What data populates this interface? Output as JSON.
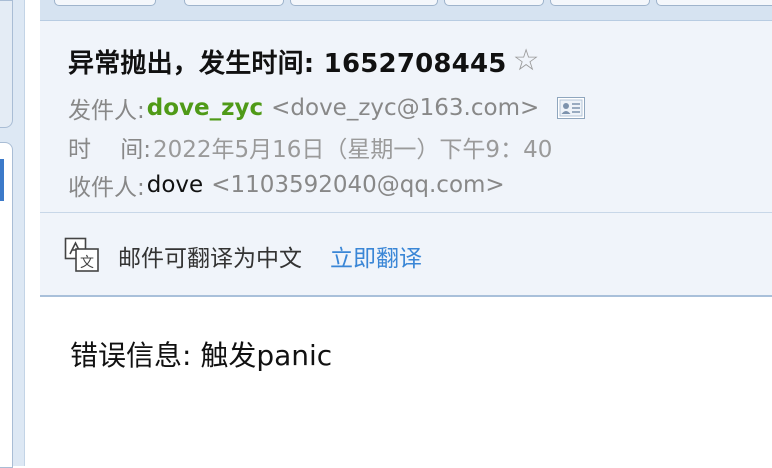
{
  "mail": {
    "subject": "异常抛出，发生时间: 1652708445",
    "from_label": "发件人:",
    "from_name": "dove_zyc",
    "from_addr": "<dove_zyc@163.com>",
    "time_label": "时    间:",
    "time_value": "2022年5月16日（星期一）下午9：40",
    "to_label": "收件人:",
    "to_name": "dove",
    "to_addr": "<1103592040@qq.com>"
  },
  "translate": {
    "text": "邮件可翻译为中文",
    "link": "立即翻译"
  },
  "body": {
    "text": "错误信息: 触发panic"
  },
  "icons": {
    "star": "star-outline-icon",
    "contact": "contact-card-icon",
    "translate": "translate-icon"
  },
  "colors": {
    "sender": "#4f9a17",
    "link": "#3a86d6",
    "header_bg": "#f0f4fa"
  }
}
